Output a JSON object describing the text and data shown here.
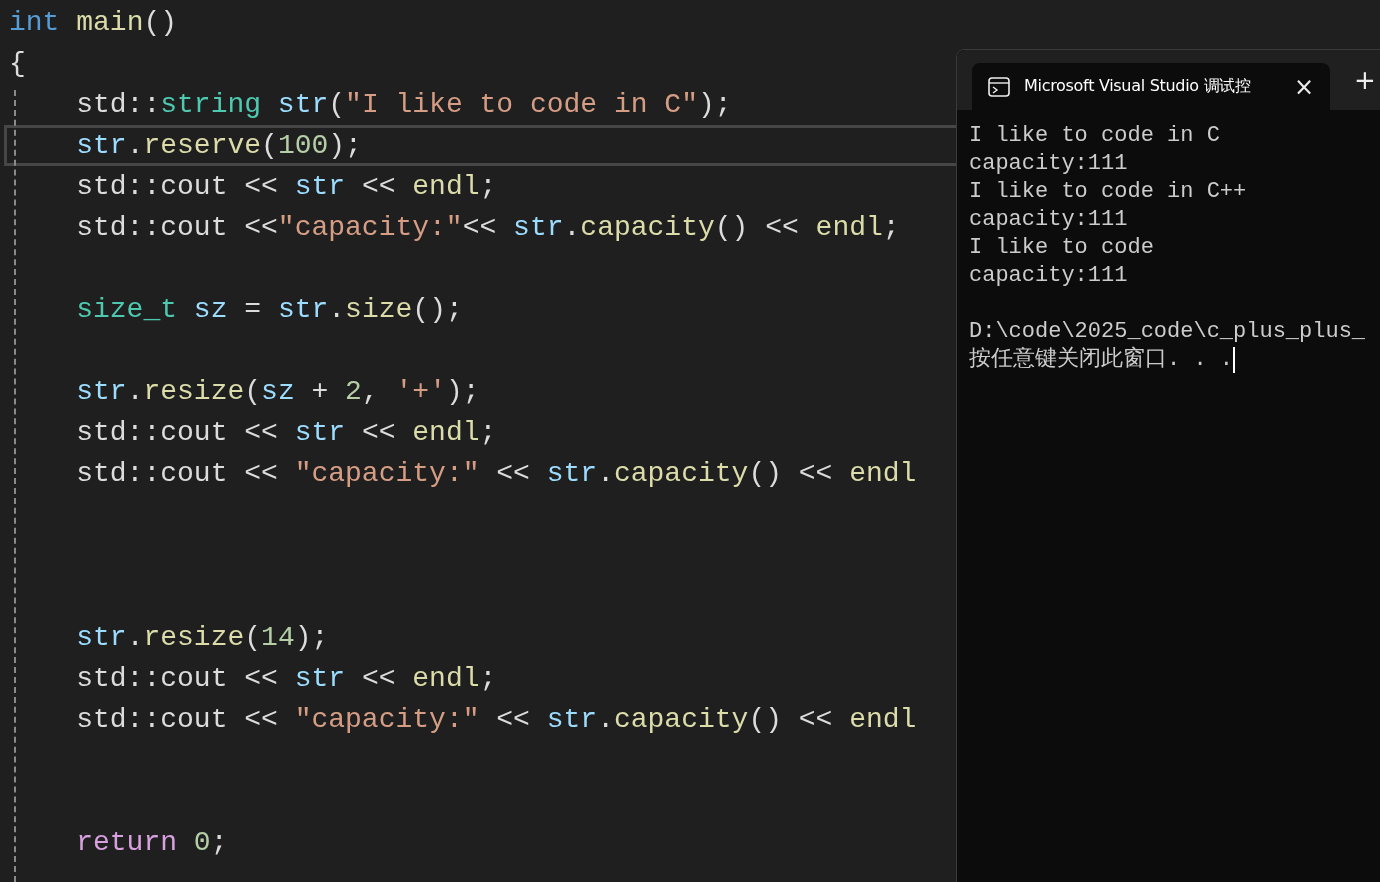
{
  "editor": {
    "lines": [
      {
        "kind": "code",
        "current": false,
        "tokens": [
          {
            "kind": "keyword",
            "text": "int"
          },
          {
            "kind": "function",
            "text": " main"
          },
          {
            "kind": "plain",
            "text": "()"
          }
        ]
      },
      {
        "kind": "code",
        "current": false,
        "tokens": [
          {
            "kind": "plain",
            "text": "{"
          }
        ]
      },
      {
        "kind": "code",
        "current": false,
        "tokens": [
          {
            "kind": "plain",
            "text": "    std::"
          },
          {
            "kind": "type",
            "text": "string"
          },
          {
            "kind": "variable",
            "text": " str"
          },
          {
            "kind": "plain",
            "text": "("
          },
          {
            "kind": "string",
            "text": "\"I like to code in C\""
          },
          {
            "kind": "plain",
            "text": ");"
          }
        ]
      },
      {
        "kind": "code",
        "current": true,
        "tokens": [
          {
            "kind": "variable",
            "text": "    str"
          },
          {
            "kind": "plain",
            "text": "."
          },
          {
            "kind": "function",
            "text": "reserve"
          },
          {
            "kind": "plain",
            "text": "("
          },
          {
            "kind": "number",
            "text": "100"
          },
          {
            "kind": "plain",
            "text": ");"
          }
        ]
      },
      {
        "kind": "code",
        "current": false,
        "tokens": [
          {
            "kind": "plain",
            "text": "    std::cout << "
          },
          {
            "kind": "variable",
            "text": "str"
          },
          {
            "kind": "plain",
            "text": " << "
          },
          {
            "kind": "function",
            "text": "endl"
          },
          {
            "kind": "plain",
            "text": ";"
          }
        ]
      },
      {
        "kind": "code",
        "current": false,
        "tokens": [
          {
            "kind": "plain",
            "text": "    std::cout <<"
          },
          {
            "kind": "string",
            "text": "\"capacity:\""
          },
          {
            "kind": "plain",
            "text": "<< "
          },
          {
            "kind": "variable",
            "text": "str"
          },
          {
            "kind": "plain",
            "text": "."
          },
          {
            "kind": "function",
            "text": "capacity"
          },
          {
            "kind": "plain",
            "text": "() << "
          },
          {
            "kind": "function",
            "text": "endl"
          },
          {
            "kind": "plain",
            "text": ";"
          }
        ]
      },
      {
        "kind": "blank",
        "current": false
      },
      {
        "kind": "code",
        "current": false,
        "tokens": [
          {
            "kind": "type",
            "text": "    size_t"
          },
          {
            "kind": "variable",
            "text": " sz"
          },
          {
            "kind": "plain",
            "text": " = "
          },
          {
            "kind": "variable",
            "text": "str"
          },
          {
            "kind": "plain",
            "text": "."
          },
          {
            "kind": "function",
            "text": "size"
          },
          {
            "kind": "plain",
            "text": "();"
          }
        ]
      },
      {
        "kind": "blank",
        "current": false
      },
      {
        "kind": "code",
        "current": false,
        "tokens": [
          {
            "kind": "variable",
            "text": "    str"
          },
          {
            "kind": "plain",
            "text": "."
          },
          {
            "kind": "function",
            "text": "resize"
          },
          {
            "kind": "plain",
            "text": "("
          },
          {
            "kind": "variable",
            "text": "sz"
          },
          {
            "kind": "plain",
            "text": " + "
          },
          {
            "kind": "number",
            "text": "2"
          },
          {
            "kind": "plain",
            "text": ", "
          },
          {
            "kind": "string",
            "text": "'+'"
          },
          {
            "kind": "plain",
            "text": ");"
          }
        ]
      },
      {
        "kind": "code",
        "current": false,
        "tokens": [
          {
            "kind": "plain",
            "text": "    std::cout << "
          },
          {
            "kind": "variable",
            "text": "str"
          },
          {
            "kind": "plain",
            "text": " << "
          },
          {
            "kind": "function",
            "text": "endl"
          },
          {
            "kind": "plain",
            "text": ";"
          }
        ]
      },
      {
        "kind": "code",
        "current": false,
        "tokens": [
          {
            "kind": "plain",
            "text": "    std::cout << "
          },
          {
            "kind": "string",
            "text": "\"capacity:\""
          },
          {
            "kind": "plain",
            "text": " << "
          },
          {
            "kind": "variable",
            "text": "str"
          },
          {
            "kind": "plain",
            "text": "."
          },
          {
            "kind": "function",
            "text": "capacity"
          },
          {
            "kind": "plain",
            "text": "() << "
          },
          {
            "kind": "function",
            "text": "endl"
          }
        ]
      },
      {
        "kind": "blank",
        "current": false
      },
      {
        "kind": "blank",
        "current": false
      },
      {
        "kind": "blank",
        "current": false
      },
      {
        "kind": "code",
        "current": false,
        "tokens": [
          {
            "kind": "variable",
            "text": "    str"
          },
          {
            "kind": "plain",
            "text": "."
          },
          {
            "kind": "function",
            "text": "resize"
          },
          {
            "kind": "plain",
            "text": "("
          },
          {
            "kind": "number",
            "text": "14"
          },
          {
            "kind": "plain",
            "text": ");"
          }
        ]
      },
      {
        "kind": "code",
        "current": false,
        "tokens": [
          {
            "kind": "plain",
            "text": "    std::cout << "
          },
          {
            "kind": "variable",
            "text": "str"
          },
          {
            "kind": "plain",
            "text": " << "
          },
          {
            "kind": "function",
            "text": "endl"
          },
          {
            "kind": "plain",
            "text": ";"
          }
        ]
      },
      {
        "kind": "code",
        "current": false,
        "tokens": [
          {
            "kind": "plain",
            "text": "    std::cout << "
          },
          {
            "kind": "string",
            "text": "\"capacity:\""
          },
          {
            "kind": "plain",
            "text": " << "
          },
          {
            "kind": "variable",
            "text": "str"
          },
          {
            "kind": "plain",
            "text": "."
          },
          {
            "kind": "function",
            "text": "capacity"
          },
          {
            "kind": "plain",
            "text": "() << "
          },
          {
            "kind": "function",
            "text": "endl"
          }
        ]
      },
      {
        "kind": "blank",
        "current": false
      },
      {
        "kind": "blank",
        "current": false
      },
      {
        "kind": "code",
        "current": false,
        "tokens": [
          {
            "kind": "control",
            "text": "    return"
          },
          {
            "kind": "number",
            "text": " 0"
          },
          {
            "kind": "plain",
            "text": ";"
          }
        ]
      }
    ]
  },
  "console": {
    "tab": {
      "title": "Microsoft Visual Studio 调试控",
      "close": "×"
    },
    "new_tab": "+",
    "output": [
      {
        "kind": "text",
        "text": "I like to code in C"
      },
      {
        "kind": "text",
        "text": "capacity:111"
      },
      {
        "kind": "text",
        "text": "I like to code in C++"
      },
      {
        "kind": "text",
        "text": "capacity:111"
      },
      {
        "kind": "text",
        "text": "I like to code"
      },
      {
        "kind": "text",
        "text": "capacity:111"
      },
      {
        "kind": "blank"
      },
      {
        "kind": "text",
        "text": "D:\\code\\2025_code\\c_plus_plus_"
      },
      {
        "kind": "text",
        "text": "按任意键关闭此窗口. . ."
      }
    ]
  }
}
